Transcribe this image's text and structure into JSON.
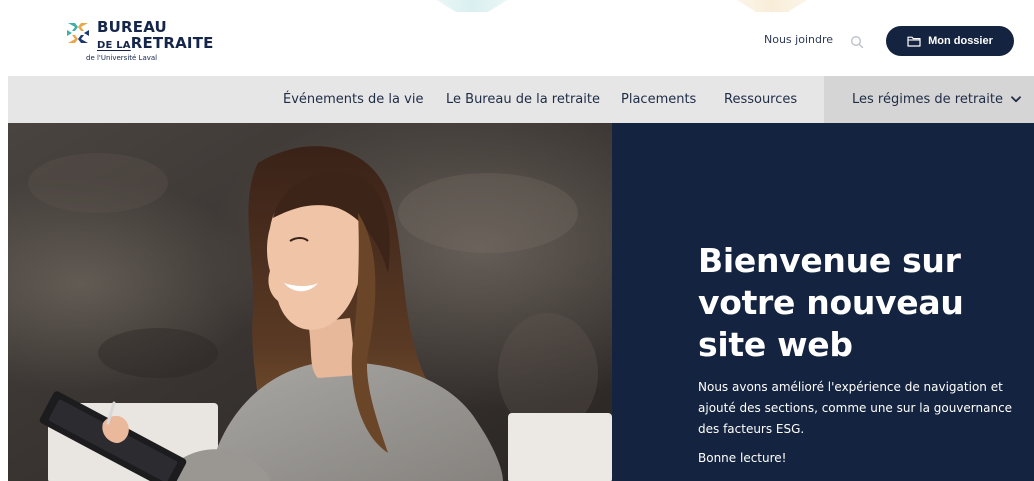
{
  "logo": {
    "line1": "BUREAU",
    "line2_small": "DE LA",
    "line2_big": "RETRAITE",
    "line3": "de l'Université Laval"
  },
  "header": {
    "contact_label": "Nous joindre",
    "search_icon": "search-icon",
    "dossier_label": "Mon dossier",
    "dossier_icon": "folder-icon"
  },
  "nav": {
    "items": [
      {
        "label": "Événements de la vie"
      },
      {
        "label": "Le Bureau de la retraite"
      },
      {
        "label": "Placements"
      },
      {
        "label": "Ressources"
      }
    ],
    "dropdown": {
      "label": "Les régimes de retraite",
      "icon": "chevron-down-icon"
    }
  },
  "hero": {
    "title": "Bienvenue sur votre nouveau site web",
    "text": "Nous avons amélioré l'expérience de navigation et ajouté des sections, comme une sur la gouvernance des facteurs ESG.",
    "sign_off": "Bonne lecture!"
  },
  "colors": {
    "navy": "#14233f",
    "nav_bg": "#e6e6e6",
    "nav_active": "#d5d5d5",
    "logo_teal": "#3fb0a8",
    "logo_orange": "#e6a84a"
  }
}
